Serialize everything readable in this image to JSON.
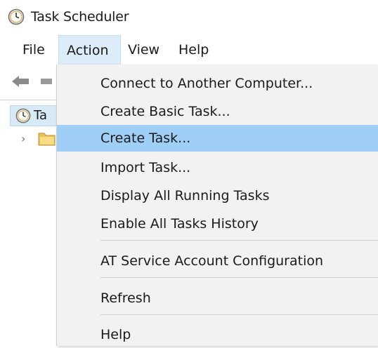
{
  "window": {
    "title": "Task Scheduler",
    "icon": "clock-icon"
  },
  "menubar": {
    "items": [
      {
        "label": "File"
      },
      {
        "label": "Action",
        "active": true
      },
      {
        "label": "View"
      },
      {
        "label": "Help"
      }
    ]
  },
  "tree": {
    "root_label": "Ta"
  },
  "action_menu": {
    "items": [
      {
        "label": "Connect to Another Computer..."
      },
      {
        "label": "Create Basic Task..."
      },
      {
        "label": "Create Task...",
        "selected": true
      },
      {
        "label": "Import Task..."
      },
      {
        "label": "Display All Running Tasks"
      },
      {
        "label": "Enable All Tasks History"
      },
      {
        "label": "AT Service Account Configuration"
      },
      {
        "label": "Refresh"
      },
      {
        "label": "Help"
      }
    ]
  },
  "colors": {
    "selected_item": "#9fcff7",
    "active_menu": "#dcecf9",
    "menu_background": "#f2f2f2"
  }
}
